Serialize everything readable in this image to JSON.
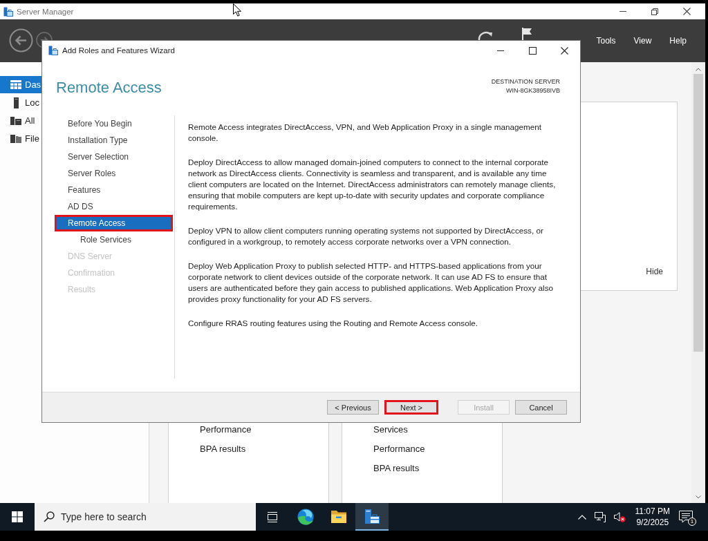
{
  "server_manager": {
    "title": "Server Manager",
    "menu": [
      "Tools",
      "View",
      "Help"
    ],
    "sidebar": [
      {
        "kind": "dashboard",
        "label": "Das",
        "selected": true
      },
      {
        "kind": "local-server",
        "label": "Loc",
        "selected": false
      },
      {
        "kind": "all-servers",
        "label": "All",
        "selected": false
      },
      {
        "kind": "file-services",
        "label": "File",
        "selected": false
      }
    ],
    "panel": {
      "hide_link": "Hide"
    },
    "tiles": [
      {
        "items": [
          "Performance",
          "BPA results"
        ]
      },
      {
        "items": [
          "Services",
          "Performance",
          "BPA results"
        ]
      }
    ]
  },
  "wizard": {
    "title": "Add Roles and Features Wizard",
    "heading": "Remote Access",
    "destination": {
      "label": "DESTINATION SERVER",
      "server": "WIN-8GK38958IVB"
    },
    "steps": [
      {
        "label": "Before You Begin",
        "selected": false,
        "disabled": false,
        "highlighted": false
      },
      {
        "label": "Installation Type",
        "selected": false,
        "disabled": false,
        "highlighted": false
      },
      {
        "label": "Server Selection",
        "selected": false,
        "disabled": false,
        "highlighted": false
      },
      {
        "label": "Server Roles",
        "selected": false,
        "disabled": false,
        "highlighted": false
      },
      {
        "label": "Features",
        "selected": false,
        "disabled": false,
        "highlighted": false
      },
      {
        "label": "AD DS",
        "selected": false,
        "disabled": false,
        "highlighted": false
      },
      {
        "label": "Remote Access",
        "selected": true,
        "disabled": false,
        "highlighted": true,
        "children": [
          {
            "label": "Role Services",
            "selected": false,
            "disabled": false,
            "highlighted": false
          }
        ]
      },
      {
        "label": "DNS Server",
        "selected": false,
        "disabled": true,
        "highlighted": false
      },
      {
        "label": "Confirmation",
        "selected": false,
        "disabled": true,
        "highlighted": false
      },
      {
        "label": "Results",
        "selected": false,
        "disabled": true,
        "highlighted": false
      }
    ],
    "paragraphs": [
      "Remote Access integrates DirectAccess, VPN, and Web Application Proxy in a single management console.",
      "Deploy DirectAccess to allow managed domain-joined computers to connect to the internal corporate network as DirectAccess clients. Connectivity is seamless and transparent, and is available any time client computers are located on the Internet. DirectAccess administrators can remotely manage clients, ensuring that mobile computers are kept up-to-date with security updates and corporate compliance requirements.",
      "Deploy VPN to allow client computers running operating systems not supported by DirectAccess, or configured in a workgroup, to remotely access corporate networks over a VPN connection.",
      "Deploy Web Application Proxy to publish selected HTTP- and HTTPS-based applications from your corporate network to client devices outside of the corporate network. It can use AD FS to ensure that users are authenticated before they gain access to published applications. Web Application Proxy also provides proxy functionality for your AD FS servers.",
      "Configure RRAS routing features using the Routing and Remote Access console."
    ],
    "buttons": [
      {
        "label": "< Previous",
        "disabled": false,
        "highlighted": false
      },
      {
        "label": "Next >",
        "disabled": false,
        "highlighted": true
      },
      {
        "label": "Install",
        "disabled": true,
        "highlighted": false
      },
      {
        "label": "Cancel",
        "disabled": false,
        "highlighted": false
      }
    ]
  },
  "taskbar": {
    "search": {
      "placeholder": "Type here to search"
    },
    "apps": [
      {
        "kind": "task-view",
        "active": false
      },
      {
        "kind": "browser",
        "active": false
      },
      {
        "kind": "file-explorer",
        "active": false
      },
      {
        "kind": "server-manager",
        "active": true
      }
    ],
    "clock": {
      "time": "11:07 PM",
      "date": "9/2/2025"
    },
    "notifications": {
      "count": "1"
    }
  }
}
